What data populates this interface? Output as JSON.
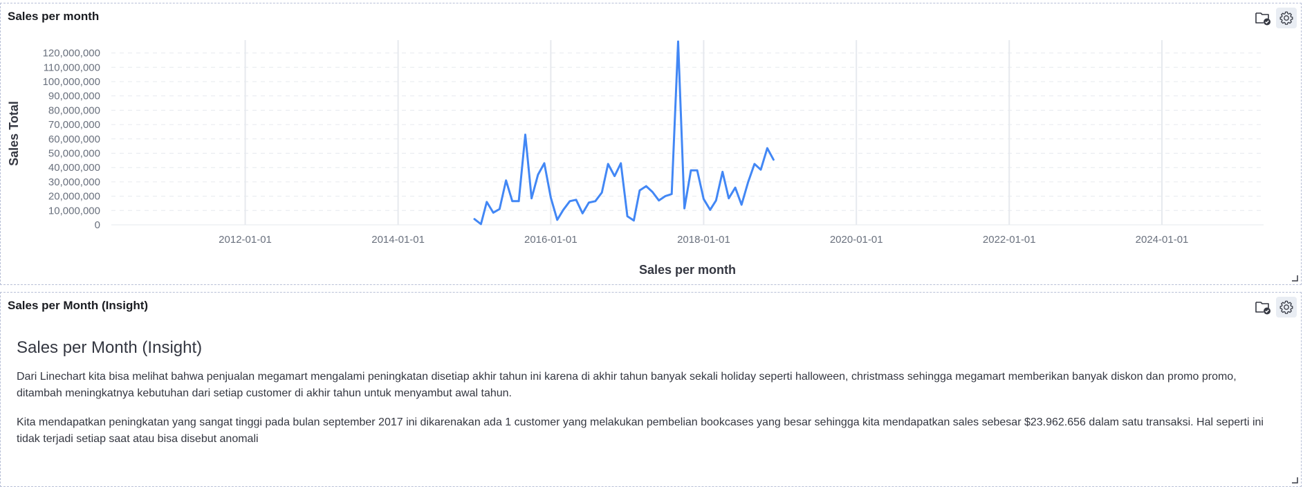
{
  "panels": {
    "chart_panel": {
      "title": "Sales per month"
    },
    "insight_panel": {
      "title": "Sales per Month (Insight)"
    }
  },
  "insight": {
    "heading": "Sales per Month (Insight)",
    "paragraphs": [
      "Dari Linechart kita bisa melihat bahwa penjualan megamart mengalami peningkatan disetiap akhir tahun ini karena di akhir tahun banyak sekali holiday seperti halloween, christmass sehingga megamart memberikan banyak diskon dan promo promo, ditambah meningkatnya kebutuhan dari setiap customer di akhir tahun untuk menyambut awal tahun.",
      "Kita mendapatkan peningkatan yang sangat tinggi pada bulan september 2017 ini dikarenakan ada 1 customer yang melakukan pembelian bookcases yang besar sehingga kita mendapatkan sales sebesar $23.962.656 dalam satu transaksi. Hal seperti ini tidak terjadi setiap saat atau bisa disebut anomali"
    ]
  },
  "icons": {
    "save": "folder-check-icon",
    "settings": "gear-icon"
  },
  "colors": {
    "line": "#4287f5",
    "grid": "#e6e9ee",
    "accent": "#006bb8"
  },
  "chart_data": {
    "type": "line",
    "title": "Sales per month",
    "xlabel": "Sales per month",
    "ylabel": "Sales Total",
    "x_ticks": [
      "2012-01-01",
      "2014-01-01",
      "2016-01-01",
      "2018-01-01",
      "2020-01-01",
      "2022-01-01",
      "2024-01-01"
    ],
    "y_ticks": [
      "0",
      "10,000,000",
      "20,000,000",
      "30,000,000",
      "40,000,000",
      "50,000,000",
      "60,000,000",
      "70,000,000",
      "80,000,000",
      "90,000,000",
      "100,000,000",
      "110,000,000",
      "120,000,000"
    ],
    "xlim": [
      "2010-04-01",
      "2025-05-01"
    ],
    "ylim": [
      0,
      128000000
    ],
    "grid": true,
    "series": [
      {
        "x": [
          "2015-01-01",
          "2015-02-01",
          "2015-03-01",
          "2015-04-01",
          "2015-05-01",
          "2015-06-01",
          "2015-07-01",
          "2015-08-01",
          "2015-09-01",
          "2015-10-01",
          "2015-11-01",
          "2015-12-01",
          "2016-01-01",
          "2016-02-01",
          "2016-03-01",
          "2016-04-01",
          "2016-05-01",
          "2016-06-01",
          "2016-07-01",
          "2016-08-01",
          "2016-09-01",
          "2016-10-01",
          "2016-11-01",
          "2016-12-01",
          "2017-01-01",
          "2017-02-01",
          "2017-03-01",
          "2017-04-01",
          "2017-05-01",
          "2017-06-01",
          "2017-07-01",
          "2017-08-01",
          "2017-09-01",
          "2017-10-01",
          "2017-11-01",
          "2017-12-01",
          "2018-01-01",
          "2018-02-01",
          "2018-03-01",
          "2018-04-01",
          "2018-05-01",
          "2018-06-01",
          "2018-07-01",
          "2018-08-01",
          "2018-09-01",
          "2018-10-01",
          "2018-11-01",
          "2018-12-01"
        ],
        "y": [
          4000000,
          500000,
          16000000,
          8500000,
          11000000,
          31000000,
          16500000,
          16500000,
          63000000,
          18500000,
          35000000,
          43000000,
          19000000,
          3500000,
          10500000,
          16500000,
          17500000,
          8000000,
          15500000,
          16500000,
          22500000,
          42500000,
          34000000,
          43000000,
          6000000,
          3000000,
          24000000,
          27000000,
          23000000,
          17000000,
          20000000,
          21500000,
          128000000,
          11500000,
          38000000,
          38000000,
          18000000,
          10500000,
          17000000,
          37000000,
          18500000,
          26000000,
          14000000,
          29500000,
          42500000,
          38500000,
          53500000,
          45500000
        ]
      }
    ]
  }
}
